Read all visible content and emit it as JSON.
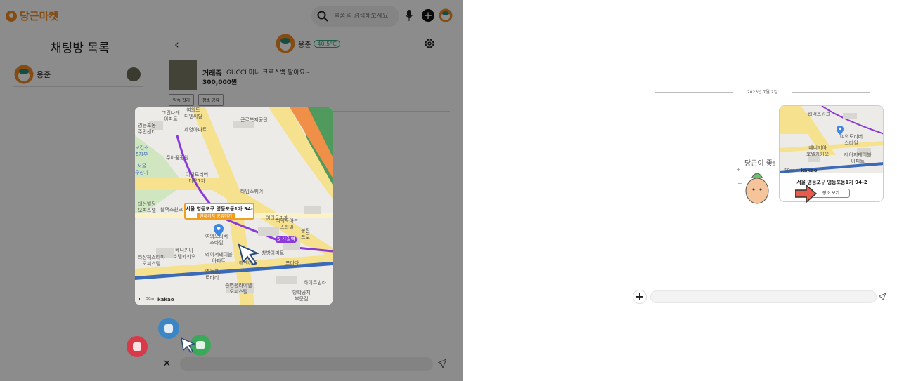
{
  "header": {
    "logo_text": "당근마켓",
    "search_placeholder": "물품을 검색해보세요"
  },
  "chat_list": {
    "title": "채팅방 목록",
    "items": [
      {
        "name": "용준"
      }
    ]
  },
  "chat": {
    "partner_name": "용준",
    "manner_temp": "40.5°C",
    "product": {
      "status": "거래중",
      "title": "GUCCI 미니 크로스백 팔아요~",
      "price": "300,000원"
    },
    "buttons": [
      "약속 잡기",
      "장소 공유"
    ],
    "input_placeholder": ""
  },
  "map_modal": {
    "address": "서울 영등포구 영등포동1가 94-2",
    "sub_label": "현재위치 공유하기",
    "labels": [
      "그린나래\n아파트",
      "여의도\n디엔씨빌",
      "영등포동\n주민센터",
      "세영아파트",
      "근로복지공단",
      "보건소\n5지부",
      "주아꿈공원",
      "여의도리버\n티오1차",
      "타임스퀘어",
      "서울\n구상가",
      "대신빌딩\n오피스텔",
      "웹맥스원크",
      "여의도미래",
      "여의도리버\n스타일",
      "봉진\n프로",
      "테이저테이블\n아파트",
      "베니키아\n호텔카키오",
      "라샹헤스티마\n오피스텔",
      "영등포\n로타리",
      "해멘아트",
      "창방아파트",
      "프라다",
      "승영평라이엘\n오피스텔",
      "하이트빌라",
      "방학공지\n부문점",
      "여의도아크\n스타일"
    ],
    "line_label": "5 신길역",
    "scale": "50m",
    "provider": "kakao"
  },
  "right": {
    "date": "2023년 7월 2일",
    "mascot_text": "당근이 좋!",
    "card": {
      "address": "서울 영등포구 영등포동1가 94-2",
      "button": "장소 보기",
      "provider": "kakao",
      "scale": "50m"
    }
  },
  "colors": {
    "brand": "#f08a24",
    "chev_green": "#16c07a",
    "chev_purple": "#9a5ad8",
    "chev_blue": "#1aa7d6"
  },
  "icons": [
    "search-icon",
    "mic-icon",
    "plus-icon",
    "gear-icon",
    "back-icon",
    "send-icon",
    "close-icon",
    "location-pin-icon",
    "cursor-icon"
  ]
}
